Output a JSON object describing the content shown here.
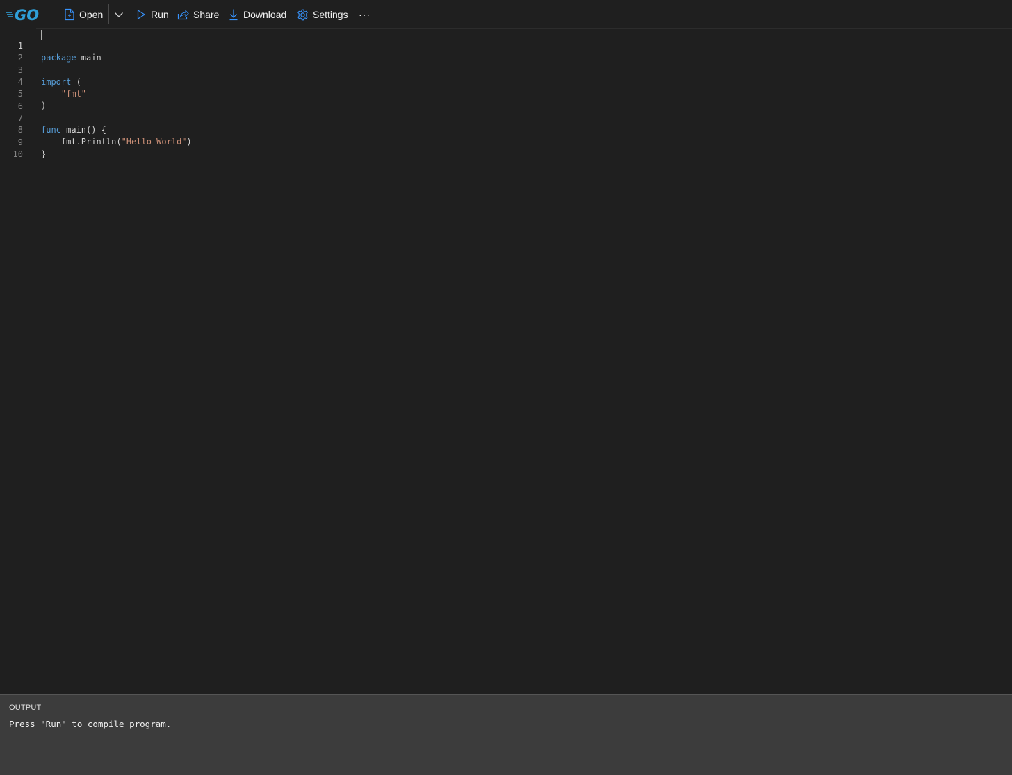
{
  "toolbar": {
    "logo_label": "GO",
    "open_label": "Open",
    "run_label": "Run",
    "share_label": "Share",
    "download_label": "Download",
    "settings_label": "Settings",
    "more_label": "···"
  },
  "editor": {
    "line_numbers": [
      "1",
      "2",
      "3",
      "4",
      "5",
      "6",
      "7",
      "8",
      "9",
      "10"
    ],
    "lines": [
      {
        "kw": "package",
        "rest": " main"
      },
      {
        "plain": ""
      },
      {
        "kw": "import",
        "rest": " ("
      },
      {
        "indent": "    ",
        "str": "\"fmt\""
      },
      {
        "plain": ")"
      },
      {
        "plain": ""
      },
      {
        "kw": "func",
        "rest": " main() {"
      },
      {
        "indent": "    ",
        "pre": "fmt.Println(",
        "str": "\"Hello World\"",
        "post": ")"
      },
      {
        "plain": "}"
      },
      {
        "plain": ""
      }
    ]
  },
  "output": {
    "title": "OUTPUT",
    "message": "Press \"Run\" to compile program."
  },
  "colors": {
    "accent": "#2f9fd8",
    "keyword": "#569cd6",
    "string": "#ce9178",
    "background": "#1f1f1f",
    "output_background": "#3c3c3c"
  }
}
